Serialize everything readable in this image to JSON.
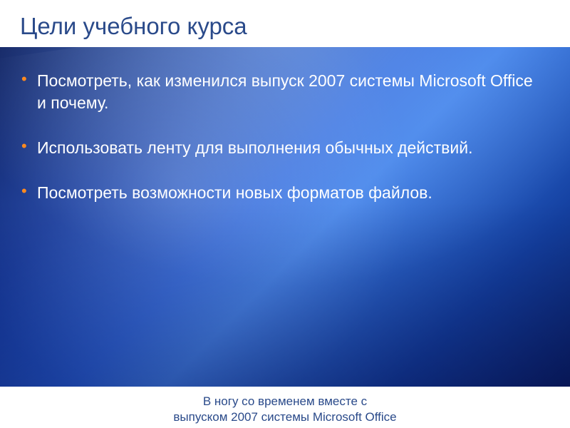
{
  "slide": {
    "title": "Цели учебного курса",
    "bullets": [
      "Посмотреть, как изменился выпуск 2007 системы Microsoft Office и почему.",
      "Использовать ленту для выполнения обычных действий.",
      "Посмотреть возможности новых форматов файлов."
    ],
    "footer": {
      "line1": "В ногу со временем вместе с",
      "line2": "выпуском 2007 системы Microsoft Office"
    }
  },
  "colors": {
    "title": "#2a4a8a",
    "bullet_marker": "#ff8a1f",
    "body_text": "#ffffff",
    "footer_text": "#2a4a8a"
  }
}
